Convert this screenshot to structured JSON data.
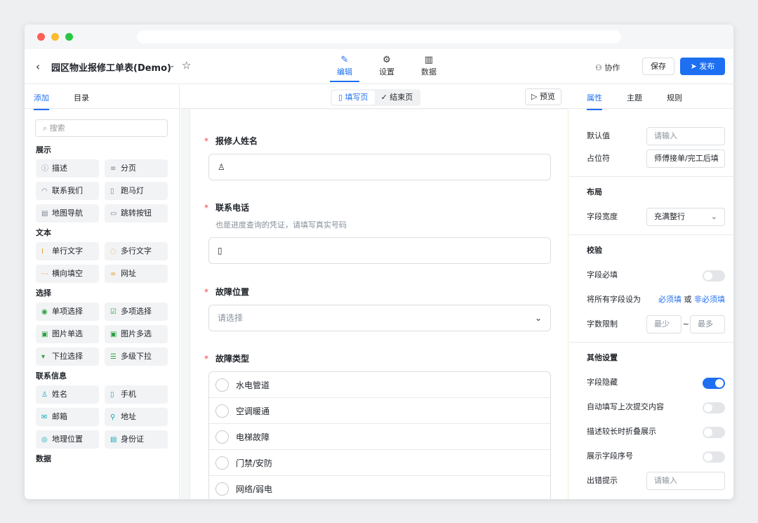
{
  "header": {
    "title": "园区物业报修工单表(Demo)",
    "tabs": [
      {
        "label": "编辑",
        "icon": "pencil-icon"
      },
      {
        "label": "设置",
        "icon": "gear-icon"
      },
      {
        "label": "数据",
        "icon": "bar-chart-icon"
      }
    ],
    "collab_label": "协作",
    "save_label": "保存",
    "publish_label": "发布"
  },
  "left": {
    "tabs": [
      "添加",
      "目录"
    ],
    "search_placeholder": "搜索",
    "groups": [
      {
        "title": "展示",
        "items": [
          "描述",
          "分页",
          "联系我们",
          "跑马灯",
          "地图导航",
          "跳转按钮"
        ]
      },
      {
        "title": "文本",
        "items": [
          "单行文字",
          "多行文字",
          "横向填空",
          "网址"
        ]
      },
      {
        "title": "选择",
        "items": [
          "单项选择",
          "多项选择",
          "图片单选",
          "图片多选",
          "下拉选择",
          "多级下拉"
        ]
      },
      {
        "title": "联系信息",
        "items": [
          "姓名",
          "手机",
          "邮箱",
          "地址",
          "地理位置",
          "身份证"
        ]
      },
      {
        "title": "数据",
        "items": []
      }
    ]
  },
  "center": {
    "page_tabs": [
      "填写页",
      "结束页"
    ],
    "preview_label": "预览",
    "fields": [
      {
        "label": "报修人姓名",
        "required": true
      },
      {
        "label": "联系电话",
        "required": true,
        "desc": "也是进度查询的凭证，请填写真实号码"
      },
      {
        "label": "故障位置",
        "required": true,
        "placeholder": "请选择"
      },
      {
        "label": "故障类型",
        "required": true,
        "options": [
          "水电管道",
          "空调暖通",
          "电梯故障",
          "门禁/安防",
          "网络/弱电"
        ]
      }
    ]
  },
  "right": {
    "tabs": [
      "属性",
      "主题",
      "规则"
    ],
    "default_label": "默认值",
    "default_placeholder": "请输入",
    "placeholder_label": "占位符",
    "placeholder_value": "师傅接单/完工后填",
    "layout_title": "布局",
    "width_label": "字段宽度",
    "width_value": "充满整行",
    "validation_title": "校验",
    "required_label": "字段必填",
    "set_all_label": "将所有字段设为",
    "must_label": "必须填",
    "or_label": "或",
    "optional_label": "非必须填",
    "limit_label": "字数限制",
    "min_placeholder": "最少",
    "max_placeholder": "最多",
    "tilde": "~",
    "other_title": "其他设置",
    "toggles": [
      {
        "label": "字段隐藏",
        "on": true
      },
      {
        "label": "自动填写上次提交内容",
        "on": false
      },
      {
        "label": "描述较长时折叠展示",
        "on": false
      },
      {
        "label": "展示字段序号",
        "on": false
      }
    ],
    "error_label": "出错提示",
    "error_placeholder": "请输入"
  }
}
